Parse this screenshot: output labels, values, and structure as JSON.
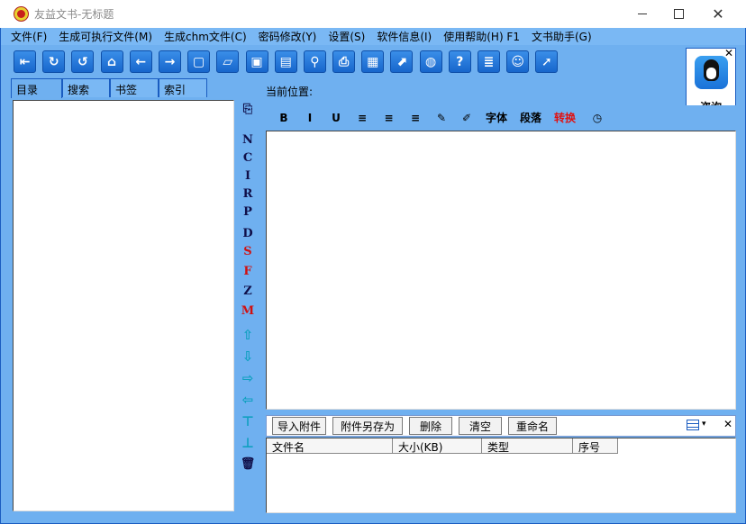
{
  "window": {
    "title": "友益文书-无标题",
    "close_glyph": "✕"
  },
  "menu": [
    "文件(F)",
    "生成可执行文件(M)",
    "生成chm文件(C)",
    "密码修改(Y)",
    "设置(S)",
    "软件信息(I)",
    "使用帮助(H) F1",
    "文书助手(G)"
  ],
  "toolbar": [
    {
      "icon": "exit-icon",
      "glyph": "⇤"
    },
    {
      "icon": "redo-icon",
      "glyph": "↻"
    },
    {
      "icon": "undo-icon",
      "glyph": "↺"
    },
    {
      "icon": "home-icon",
      "glyph": "⌂"
    },
    {
      "icon": "back-arrow-icon",
      "glyph": "←"
    },
    {
      "icon": "forward-arrow-icon",
      "glyph": "→"
    },
    {
      "icon": "new-document-icon",
      "glyph": "▢"
    },
    {
      "icon": "open-folder-icon",
      "glyph": "▱"
    },
    {
      "icon": "save-icon",
      "glyph": "▣"
    },
    {
      "icon": "save-as-icon",
      "glyph": "▤"
    },
    {
      "icon": "search-icon",
      "glyph": "⚲"
    },
    {
      "icon": "print-icon",
      "glyph": "⎙"
    },
    {
      "icon": "notes-icon",
      "glyph": "▦"
    },
    {
      "icon": "export-icon",
      "glyph": "⬈"
    },
    {
      "icon": "web-icon",
      "glyph": "◍"
    },
    {
      "icon": "help-icon",
      "glyph": "?"
    },
    {
      "icon": "page-list-icon",
      "glyph": "≣"
    },
    {
      "icon": "smiley-icon",
      "glyph": "☺"
    },
    {
      "icon": "cursor-icon",
      "glyph": "➚"
    }
  ],
  "qq": {
    "label": "咨询",
    "close_glyph": "✕"
  },
  "left_tabs": [
    "目录",
    "搜索",
    "书签",
    "索引"
  ],
  "vertical_tools": [
    {
      "text": "⎘",
      "icon": "insert-node-icon",
      "color": "navy"
    },
    {
      "text": "N",
      "color": "navy"
    },
    {
      "text": "C",
      "color": "navy"
    },
    {
      "text": "I",
      "color": "navy"
    },
    {
      "text": "R",
      "color": "navy"
    },
    {
      "text": "P",
      "color": "navy"
    },
    {
      "text": "D",
      "color": "navy"
    },
    {
      "text": "S",
      "color": "red"
    },
    {
      "text": "F",
      "color": "red"
    },
    {
      "text": "Z",
      "color": "navy"
    },
    {
      "text": "M",
      "color": "red"
    },
    {
      "text": "⇧",
      "icon": "move-up-icon",
      "color": "arrow"
    },
    {
      "text": "⇩",
      "icon": "move-down-icon",
      "color": "arrow"
    },
    {
      "text": "⇨",
      "icon": "move-right-icon",
      "color": "arrow"
    },
    {
      "text": "⇦",
      "icon": "move-left-icon",
      "color": "arrow"
    },
    {
      "text": "⊤",
      "icon": "move-top-icon",
      "color": "arrow"
    },
    {
      "text": "⊥",
      "icon": "move-bottom-icon",
      "color": "arrow"
    },
    {
      "text": "🗑",
      "icon": "recycle-bin-icon",
      "color": "navy"
    }
  ],
  "location_label": "当前位置:",
  "editor_toolbar": [
    {
      "text": "B",
      "name": "bold-button",
      "width": 28,
      "color": "black"
    },
    {
      "text": "I",
      "name": "italic-button",
      "width": 30,
      "color": "black"
    },
    {
      "text": "U",
      "name": "underline-button",
      "width": 28,
      "color": "black"
    },
    {
      "text": "≡",
      "name": "align-left-button",
      "width": 30,
      "color": "black"
    },
    {
      "text": "≡",
      "name": "align-center-button",
      "width": 29,
      "color": "black"
    },
    {
      "text": "≡",
      "name": "align-right-button",
      "width": 30,
      "color": "black"
    },
    {
      "text": "✎",
      "name": "format-brush-icon",
      "width": 28,
      "color": "black"
    },
    {
      "text": "✐",
      "name": "color-picker-icon",
      "width": 28,
      "color": "black"
    },
    {
      "text": "字体",
      "name": "font-button",
      "width": 38,
      "color": "black"
    },
    {
      "text": "段落",
      "name": "paragraph-button",
      "width": 38,
      "color": "black"
    },
    {
      "text": "转换",
      "name": "convert-button",
      "width": 38,
      "color": "red"
    },
    {
      "text": "◷",
      "name": "clock-icon",
      "width": 34,
      "color": "black"
    }
  ],
  "attachment_buttons": [
    "导入附件",
    "附件另存为",
    "删除",
    "清空",
    "重命名"
  ],
  "attachment_close": "✕",
  "attachment_columns": [
    "文件名",
    "大小(KB)",
    "类型",
    "序号"
  ]
}
